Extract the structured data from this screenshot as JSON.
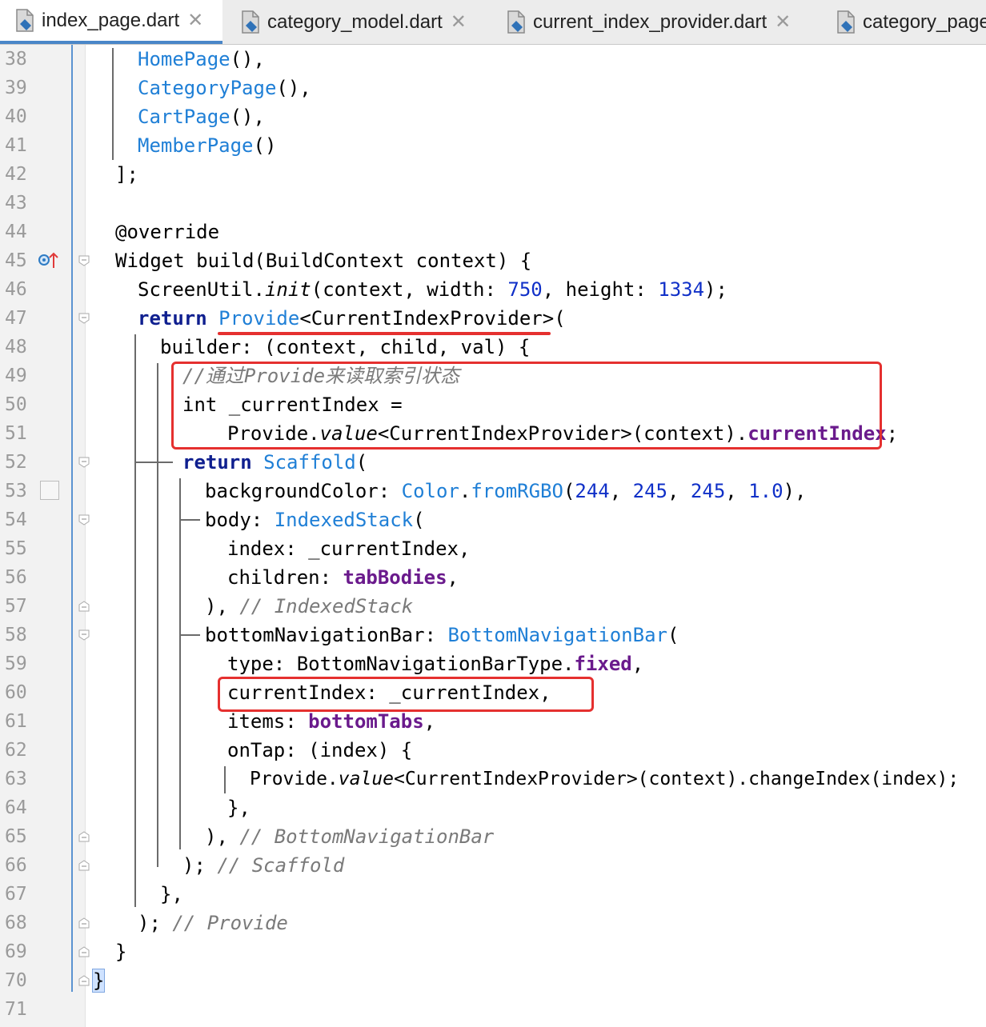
{
  "tabs": [
    {
      "label": "index_page.dart",
      "active": true
    },
    {
      "label": "category_model.dart",
      "active": false
    },
    {
      "label": "current_index_provider.dart",
      "active": false
    },
    {
      "label": "category_page",
      "active": false
    }
  ],
  "line_numbers": [
    "38",
    "39",
    "40",
    "41",
    "42",
    "43",
    "44",
    "45",
    "46",
    "47",
    "48",
    "49",
    "50",
    "51",
    "52",
    "53",
    "54",
    "55",
    "56",
    "57",
    "58",
    "59",
    "60",
    "61",
    "62",
    "63",
    "64",
    "65",
    "66",
    "67",
    "68",
    "69",
    "70",
    "71"
  ],
  "code": {
    "l38": {
      "cls": "HomePage",
      "rest": "(),"
    },
    "l39": {
      "cls": "CategoryPage",
      "rest": "(),"
    },
    "l40": {
      "cls": "CartPage",
      "rest": "(),"
    },
    "l41": {
      "cls": "MemberPage",
      "rest": "()"
    },
    "l42": {
      "text": "];"
    },
    "l44": {
      "text": "@override"
    },
    "l45": {
      "text": "Widget build(BuildContext context) {"
    },
    "l46": {
      "a": "ScreenUtil.",
      "b": "init",
      "c": "(context, width: ",
      "n1": "750",
      "d": ", height: ",
      "n2": "1334",
      "e": ");"
    },
    "l47": {
      "kw": "return",
      "cls": "Provide",
      "rest": "<CurrentIndexProvider>("
    },
    "l48": {
      "text": "builder: (context, child, val) {"
    },
    "l49": {
      "text": "//通过Provide来读取索引状态"
    },
    "l50": {
      "text": "int _currentIndex ="
    },
    "l51": {
      "a": "Provide.",
      "b": "value",
      "c": "<CurrentIndexProvider>(context).",
      "fld": "currentIndex",
      "e": ";"
    },
    "l52": {
      "kw": "return",
      "cls": "Scaffold",
      "rest": "("
    },
    "l53": {
      "a": "backgroundColor: ",
      "cls": "Color",
      "dot": ".",
      "cls2": "fromRGBO",
      "p": "(",
      "n1": "244",
      "s1": ", ",
      "n2": "245",
      "s2": ", ",
      "n3": "245",
      "s3": ", ",
      "n4": "1.0",
      "e": "),"
    },
    "l54": {
      "a": "body: ",
      "cls": "IndexedStack",
      "rest": "("
    },
    "l55": {
      "text": "index: _currentIndex,"
    },
    "l56": {
      "a": "children: ",
      "fld": "tabBodies",
      "e": ","
    },
    "l57": {
      "a": "), ",
      "cmt": "// IndexedStack"
    },
    "l58": {
      "a": "bottomNavigationBar: ",
      "cls": "BottomNavigationBar",
      "rest": "("
    },
    "l59": {
      "a": "type: BottomNavigationBarType.",
      "fld": "fixed",
      "e": ","
    },
    "l60": {
      "text": "currentIndex: _currentIndex,"
    },
    "l61": {
      "a": "items: ",
      "fld": "bottomTabs",
      "e": ","
    },
    "l62": {
      "text": "onTap: (index) {"
    },
    "l63": {
      "a": "Provide.",
      "b": "value",
      "c": "<CurrentIndexProvider>(context).changeIndex(index);"
    },
    "l64": {
      "text": "},"
    },
    "l65": {
      "a": "), ",
      "cmt": "// BottomNavigationBar"
    },
    "l66": {
      "a": "); ",
      "cmt": "// Scaffold"
    },
    "l67": {
      "text": "},"
    },
    "l68": {
      "a": "); ",
      "cmt": "// Provide"
    },
    "l69": {
      "text": "}"
    },
    "l70": {
      "text": "}"
    }
  },
  "colors": {
    "annotation": "#e5302f",
    "keyword": "#0f1f8f",
    "class": "#1f7fd6",
    "number": "#1030c8",
    "field": "#6a1a8c",
    "comment": "#7a7a7a"
  },
  "icons": [
    "dart-file-icon",
    "close-icon",
    "override-marker-icon",
    "fold-icon",
    "breakpoint-slot-icon"
  ]
}
